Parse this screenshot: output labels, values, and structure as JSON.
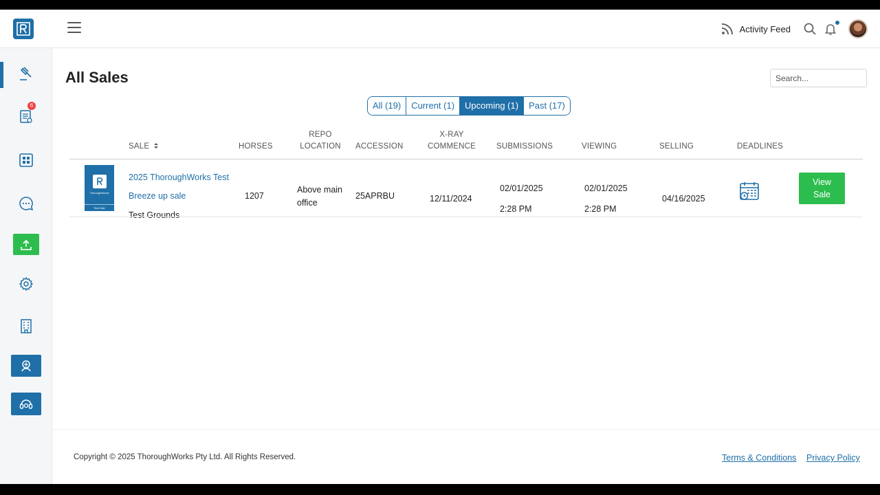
{
  "header": {
    "activity_feed_label": "Activity Feed",
    "brand_color": "#1f6fa8"
  },
  "sidebar": {
    "items": [
      {
        "icon": "gavel-icon",
        "active": true
      },
      {
        "icon": "clipboard-list-icon",
        "badge": "6"
      },
      {
        "icon": "dashboard-grid-icon"
      },
      {
        "icon": "chat-bubble-icon"
      },
      {
        "icon": "upload-icon",
        "color": "#2dbd4e"
      },
      {
        "icon": "gear-icon"
      },
      {
        "icon": "building-icon"
      },
      {
        "icon": "vet-badge-icon",
        "color": "#1f6fa8"
      },
      {
        "icon": "headset-support-icon",
        "color": "#1f6fa8"
      }
    ]
  },
  "main": {
    "title": "All Sales",
    "search_placeholder": "Search...",
    "tabs": [
      {
        "label": "All (19)",
        "active": false
      },
      {
        "label": "Current (1)",
        "active": false
      },
      {
        "label": "Upcoming (1)",
        "active": true
      },
      {
        "label": "Past (17)",
        "active": false
      }
    ],
    "columns": {
      "sale": "SALE",
      "horses": "HORSES",
      "repo_line1": "REPO",
      "repo_line2": "LOCATION",
      "accession": "ACCESSION",
      "xray_line1": "X-RAY",
      "xray_line2": "COMMENCE",
      "submissions": "SUBMISSIONS",
      "viewing": "VIEWING",
      "selling": "SELLING",
      "deadlines": "DEADLINES"
    },
    "rows": [
      {
        "thumb_brand": "ThoroughWorks",
        "thumb_caption": "Test Sale",
        "sale_name_line1": "2025 ThoroughWorks Test",
        "sale_name_line2": "Breeze up sale",
        "venue": "Test Grounds",
        "horses": "1207",
        "repo_line1": "Above main",
        "repo_line2": "office",
        "accession": "25APRBU",
        "xray_commence": "12/11/2024",
        "submissions_date": "02/01/2025",
        "submissions_time": "2:28 PM",
        "viewing_date": "02/01/2025",
        "viewing_time": "2:28 PM",
        "selling": "04/16/2025",
        "deadlines_icon": "calendar-clock-icon",
        "action_line1": "View",
        "action_line2": "Sale"
      }
    ]
  },
  "footer": {
    "copyright": "Copyright © 2025 ThoroughWorks Pty Ltd. All Rights Reserved.",
    "terms": "Terms & Conditions",
    "privacy": "Privacy Policy"
  }
}
